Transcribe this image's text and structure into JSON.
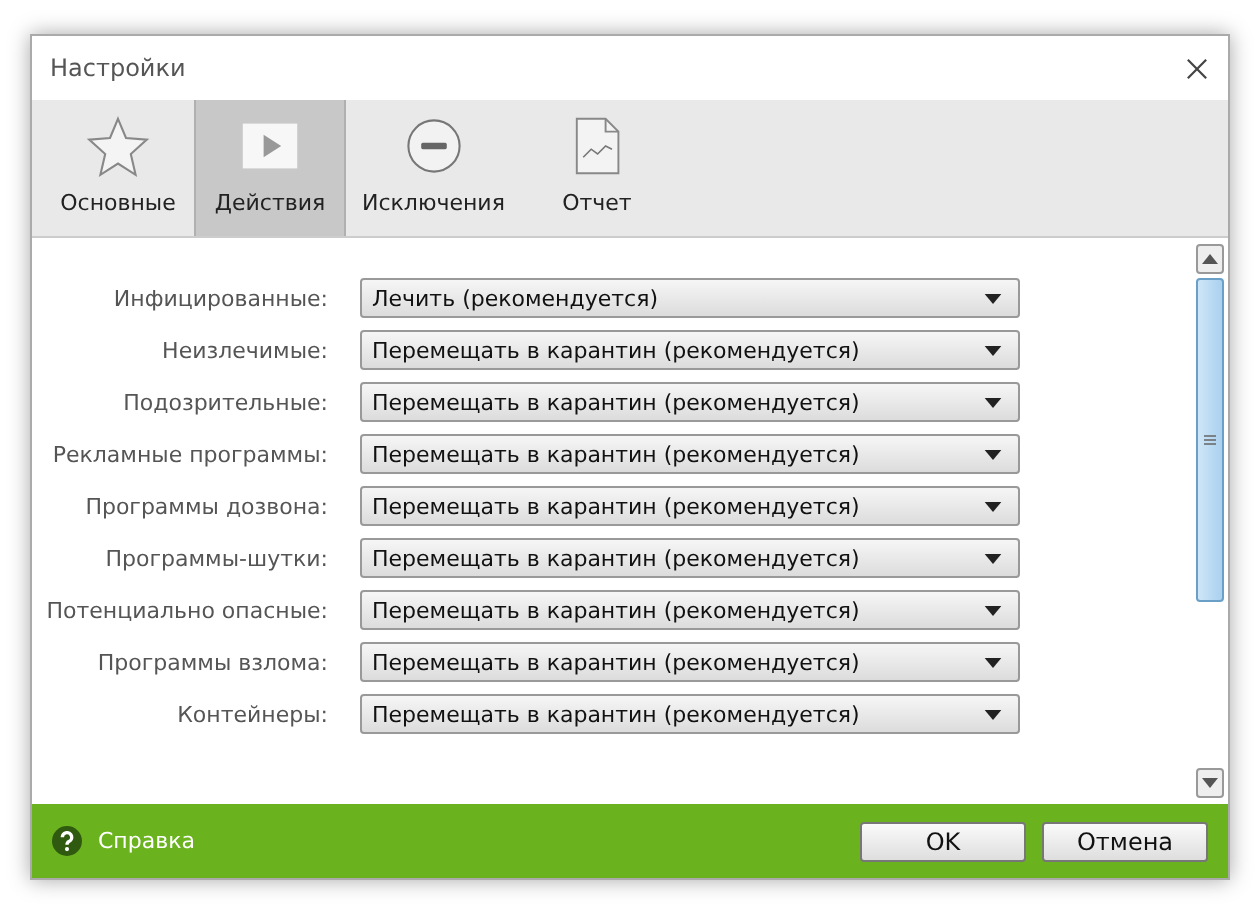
{
  "window": {
    "title": "Настройки"
  },
  "tabs": [
    {
      "label": "Основные",
      "kind": "star",
      "selected": false
    },
    {
      "label": "Действия",
      "kind": "play",
      "selected": true
    },
    {
      "label": "Исключения",
      "kind": "minus",
      "selected": false
    },
    {
      "label": "Отчет",
      "kind": "report",
      "selected": false
    }
  ],
  "actions": [
    {
      "label": "Инфицированные:",
      "value": "Лечить (рекомендуется)"
    },
    {
      "label": "Неизлечимые:",
      "value": "Перемещать в карантин (рекомендуется)"
    },
    {
      "label": "Подозрительные:",
      "value": "Перемещать в карантин (рекомендуется)"
    },
    {
      "label": "Рекламные программы:",
      "value": "Перемещать в карантин (рекомендуется)"
    },
    {
      "label": "Программы дозвона:",
      "value": "Перемещать в карантин (рекомендуется)"
    },
    {
      "label": "Программы-шутки:",
      "value": "Перемещать в карантин (рекомендуется)"
    },
    {
      "label": "Потенциально опасные:",
      "value": "Перемещать в карантин (рекомендуется)"
    },
    {
      "label": "Программы взлома:",
      "value": "Перемещать в карантин (рекомендуется)"
    },
    {
      "label": "Контейнеры:",
      "value": "Перемещать в карантин (рекомендуется)"
    }
  ],
  "footer": {
    "help": "Справка",
    "buttons": [
      "OK",
      "Отмена"
    ]
  }
}
